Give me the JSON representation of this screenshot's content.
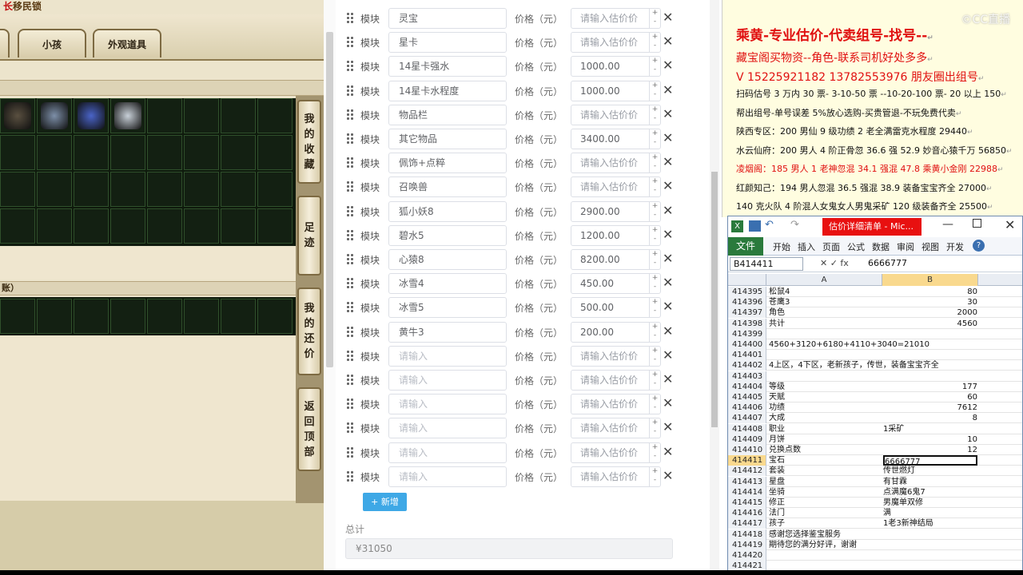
{
  "game": {
    "title_prefix": "长",
    "title": "移民锁",
    "tabs": [
      "小孩",
      "外观道具"
    ],
    "section2_label": "账）",
    "side_tabs": [
      [
        "我",
        "的",
        "收",
        "藏"
      ],
      [
        "足",
        "迹"
      ],
      [
        "我",
        "的",
        "还",
        "价"
      ],
      [
        "返",
        "回",
        "顶",
        "部"
      ]
    ]
  },
  "form": {
    "module_label": "模块",
    "price_label": "价格（元）",
    "rows": [
      {
        "name": "灵宝",
        "price": ""
      },
      {
        "name": "星卡",
        "price": ""
      },
      {
        "name": "14星卡强水",
        "price": "1000.00"
      },
      {
        "name": "14星卡水程度",
        "price": "1000.00"
      },
      {
        "name": "物品栏",
        "price": ""
      },
      {
        "name": "其它物品",
        "price": "3400.00"
      },
      {
        "name": "佩饰+点粹",
        "price": ""
      },
      {
        "name": "召唤兽",
        "price": ""
      },
      {
        "name": "狐小妖8",
        "price": "2900.00"
      },
      {
        "name": "碧水5",
        "price": "1200.00"
      },
      {
        "name": "心猿8",
        "price": "8200.00"
      },
      {
        "name": "冰雪4",
        "price": "450.00"
      },
      {
        "name": "冰雪5",
        "price": "500.00"
      },
      {
        "name": "黄牛3",
        "price": "200.00"
      },
      {
        "name": "",
        "price": ""
      },
      {
        "name": "",
        "price": ""
      },
      {
        "name": "",
        "price": ""
      },
      {
        "name": "",
        "price": ""
      },
      {
        "name": "",
        "price": ""
      },
      {
        "name": "",
        "price": ""
      }
    ],
    "name_placeholder": "请输入",
    "price_placeholder": "请输入估价价",
    "add_button": "+ 新增",
    "total_label": "总计",
    "total_value": "¥31050"
  },
  "notes": {
    "heading": "乘黄-专业估价-代卖组号-找号--",
    "lines": [
      {
        "text": "藏宝阁买物资--角色-联系司机好处多多",
        "color": "#e01010"
      },
      {
        "text": "V 15225921182    13782553976 朋友圈出组号",
        "color": "#e01010"
      },
      {
        "text": "扫码估号 3 万内 30 票- 3-10-50 票  --10-20-100 票- 20 以上 150",
        "color": "#111111"
      },
      {
        "text": "帮出组号-单号误差 5%放心选购-买贵管退-不玩免费代卖",
        "color": "#111111"
      },
      {
        "text": "陕西专区：200 男仙 9 级功绩 2 老全满雷克水程度 29440",
        "color": "#111111"
      },
      {
        "text": "水云仙府：200 男人 4 阶正骨忽 36.6 强 52.9 妙音心猿千万 56850",
        "color": "#111111"
      },
      {
        "text": "凌烟阁：185 男人 1 老神忽混 34.1 强混 47.8 乘黄小金刚 22988",
        "color": "#e01010"
      },
      {
        "text": "红颜知己：194 男人忽混 36.5 强混 38.9 装备宝宝齐全 27000",
        "color": "#111111"
      },
      {
        "text": "140 克火队 4 阶混人女鬼女人男鬼采矿 120 级装备齐全 25500",
        "color": "#111111"
      }
    ]
  },
  "excel": {
    "title": "估价详细清单 - Mic...",
    "ribbon_file": "文件",
    "ribbon_tabs": [
      "开始",
      "插入",
      "页面",
      "公式",
      "数据",
      "审阅",
      "视图",
      "开发"
    ],
    "name_box": "B414411",
    "formula_value": "6666777",
    "col_a": "A",
    "col_b": "B",
    "rows": [
      {
        "n": "414395",
        "a": "松鼠4",
        "b": "80",
        "num": true
      },
      {
        "n": "414396",
        "a": "苍鹰3",
        "b": "30",
        "num": true
      },
      {
        "n": "414397",
        "a": "角色",
        "b": "2000",
        "num": true
      },
      {
        "n": "414398",
        "a": "共计",
        "b": "4560",
        "num": true
      },
      {
        "n": "414399",
        "a": "",
        "b": "",
        "num": false
      },
      {
        "n": "414400",
        "a": "4560+3120+6180+4110+3040=21010",
        "b": "",
        "num": false
      },
      {
        "n": "414401",
        "a": "",
        "b": "",
        "num": false
      },
      {
        "n": "414402",
        "a": "4上区，4下区，老新孩子，传世，装备宝宝齐全",
        "b": "",
        "num": false
      },
      {
        "n": "414403",
        "a": "",
        "b": "",
        "num": false
      },
      {
        "n": "414404",
        "a": "等级",
        "b": "177",
        "num": true
      },
      {
        "n": "414405",
        "a": "天赋",
        "b": "60",
        "num": true
      },
      {
        "n": "414406",
        "a": "功绩",
        "b": "7612",
        "num": true
      },
      {
        "n": "414407",
        "a": "大成",
        "b": "8",
        "num": true
      },
      {
        "n": "414408",
        "a": "职业",
        "b": "1采矿",
        "num": false
      },
      {
        "n": "414409",
        "a": "月饼",
        "b": "10",
        "num": true
      },
      {
        "n": "414410",
        "a": "兑换点数",
        "b": "12",
        "num": true
      },
      {
        "n": "414411",
        "a": "宝石",
        "b": "6666777",
        "num": false
      },
      {
        "n": "414412",
        "a": "套装",
        "b": "传世燃灯",
        "num": false
      },
      {
        "n": "414413",
        "a": "星盘",
        "b": "有甘霖",
        "num": false
      },
      {
        "n": "414414",
        "a": "坐骑",
        "b": "点满魔6鬼7",
        "num": false
      },
      {
        "n": "414415",
        "a": "修正",
        "b": "男魔单双修",
        "num": false
      },
      {
        "n": "414416",
        "a": "法门",
        "b": "满",
        "num": false
      },
      {
        "n": "414417",
        "a": "孩子",
        "b": "1老3新神结局",
        "num": false
      },
      {
        "n": "414418",
        "a": "感谢您选择鉴宝服务",
        "b": "",
        "num": false
      },
      {
        "n": "414419",
        "a": "期待您的满分好评，谢谢",
        "b": "",
        "num": false
      },
      {
        "n": "414420",
        "a": "",
        "b": "",
        "num": false
      },
      {
        "n": "414421",
        "a": "",
        "b": "",
        "num": false
      }
    ]
  },
  "watermark": "©CC直播",
  "colors": {
    "accent_blue": "#3ea8e6",
    "note_red": "#e01010",
    "excel_green": "#2a7a3c"
  }
}
